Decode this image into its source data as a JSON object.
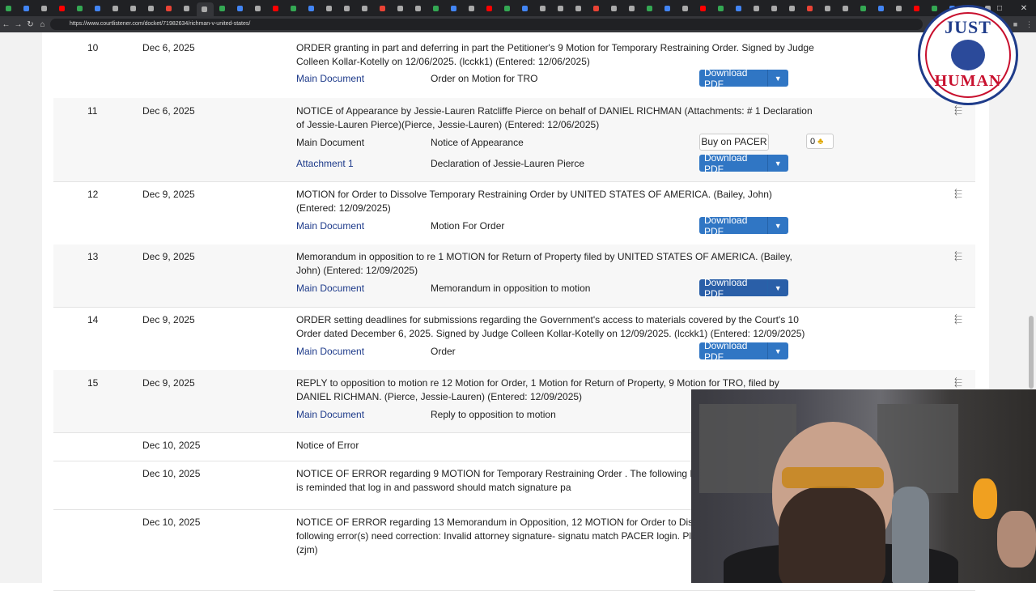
{
  "browser": {
    "url": "https://www.courtlistener.com/docket/71982634/richman-v-united-states/",
    "tab_count": 56,
    "tab_colors": [
      "#34a853",
      "#4285f4",
      "#aaa",
      "#ff0000",
      "#34a853",
      "#4285f4",
      "#aaa",
      "#aaa",
      "#aaa",
      "#ea4335",
      "#aaa",
      "#aaa"
    ]
  },
  "entries": [
    {
      "num": "10",
      "date": "Dec 6, 2025",
      "shaded": false,
      "desc": "ORDER granting in part and deferring in part the Petitioner's 9 Motion for Temporary Restraining Order. Signed by Judge Colleen Kollar-Kotelly on 12/06/2025. (lcckk1) (Entered: 12/06/2025)",
      "docs": [
        {
          "name": "Main Document",
          "desc": "Order on Motion for TRO",
          "action": "download",
          "link": true
        }
      ]
    },
    {
      "num": "11",
      "date": "Dec 6, 2025",
      "shaded": true,
      "desc": "NOTICE of Appearance by Jessie-Lauren Ratcliffe Pierce on behalf of DANIEL RICHMAN (Attachments: # 1 Declaration of Jessie-Lauren Pierce)(Pierce, Jessie-Lauren) (Entered: 12/06/2025)",
      "docs": [
        {
          "name": "Main Document",
          "desc": "Notice of Appearance",
          "action": "pacer",
          "link": false,
          "tag_count": "0"
        },
        {
          "name": "Attachment 1",
          "desc": "Declaration of Jessie-Lauren Pierce",
          "action": "download",
          "link": true
        }
      ]
    },
    {
      "num": "12",
      "date": "Dec 9, 2025",
      "shaded": false,
      "desc": "MOTION for Order to Dissolve Temporary Restraining Order by UNITED STATES OF AMERICA. (Bailey, John) (Entered: 12/09/2025)",
      "docs": [
        {
          "name": "Main Document",
          "desc": "Motion For Order",
          "action": "download",
          "link": true
        }
      ]
    },
    {
      "num": "13",
      "date": "Dec 9, 2025",
      "shaded": true,
      "desc": "Memorandum in opposition to re 1 MOTION for Return of Property filed by UNITED STATES OF AMERICA. (Bailey, John) (Entered: 12/09/2025)",
      "docs": [
        {
          "name": "Main Document",
          "desc": "Memorandum in opposition to motion",
          "action": "download",
          "link": true,
          "hover": true
        }
      ]
    },
    {
      "num": "14",
      "date": "Dec 9, 2025",
      "shaded": false,
      "desc": "ORDER setting deadlines for submissions regarding the Government's access to materials covered by the Court's 10 Order dated December 6, 2025. Signed by Judge Colleen Kollar-Kotelly on 12/09/2025. (lcckk1) (Entered: 12/09/2025)",
      "docs": [
        {
          "name": "Main Document",
          "desc": "Order",
          "action": "download",
          "link": true
        }
      ]
    },
    {
      "num": "15",
      "date": "Dec 9, 2025",
      "shaded": true,
      "desc": "REPLY to opposition to motion re 12 Motion for Order, 1 Motion for Return of Property, 9 Motion for TRO, filed by DANIEL RICHMAN. (Pierce, Jessie-Lauren) (Entered: 12/09/2025)",
      "docs": [
        {
          "name": "Main Document",
          "desc": "Reply to opposition to motion",
          "action": "none",
          "link": true
        }
      ]
    },
    {
      "num": "",
      "date": "Dec 10, 2025",
      "shaded": false,
      "desc": "Notice of Error",
      "docs": []
    },
    {
      "num": "",
      "date": "Dec 10, 2025",
      "shaded": false,
      "desc": "NOTICE OF ERROR regarding 9 MOTION for Temporary Restraining Order . The following DO NOT REFILE. Counsel is reminded that log in and password should match signature pa",
      "docs": []
    },
    {
      "num": "",
      "date": "Dec 10, 2025",
      "shaded": false,
      "desc": "NOTICE OF ERROR regarding 13 Memorandum in Opposition, 12 MOTION for Order to Dis Restraining Order. The following error(s) need correction: Invalid attorney signature- signatu match PACER login. Please refile as an Errata. (zjm)",
      "docs": []
    }
  ],
  "labels": {
    "download": "Download PDF",
    "pacer": "Buy on PACER"
  },
  "logo": {
    "top_text": "JUST",
    "bottom_text": "HUMAN"
  },
  "colors": {
    "link": "#1d3a8a",
    "button": "#3076c4",
    "logo_blue": "#1f3c8a",
    "logo_red": "#c8102e"
  }
}
